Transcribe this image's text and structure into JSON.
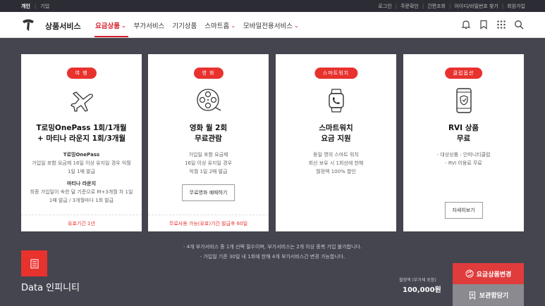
{
  "topbar": {
    "personal": "개인",
    "business": "기업",
    "links": [
      "로그인",
      "주문확인",
      "간편조회",
      "아이디/비밀번호 찾기",
      "회원가입"
    ]
  },
  "header": {
    "brand": "상품서비스",
    "nav": [
      {
        "label": "요금상품",
        "has_chevron": true,
        "active": true
      },
      {
        "label": "부가서비스",
        "has_chevron": false
      },
      {
        "label": "기기상품",
        "has_chevron": false
      },
      {
        "label": "스마트홈",
        "has_chevron": true
      },
      {
        "label": "모바일전용서비스",
        "has_chevron": true
      }
    ],
    "icons": [
      "bell-icon",
      "bookmark-icon",
      "grid-menu-icon",
      "search-icon"
    ]
  },
  "cards": [
    {
      "tag": "여 행",
      "icon": "airplane-icon",
      "title1": "T로밍OnePass 1회/1개월",
      "title2": "+ 마티나 라운지 1회/3개월",
      "desc": [
        {
          "text": "T로밍OnePass",
          "sub": true
        },
        {
          "text": "가입일 포함 요금제 16일 이상 유지일 경우 익월"
        },
        {
          "text": "1일 1매 발급"
        },
        {
          "text": "마티나 라운지",
          "sub": true
        },
        {
          "text": "최종 가입일이 속한 달 기준으로 M+3개월 차 1일"
        },
        {
          "text": "1매 발급 / 3개월마다 1회 발급"
        }
      ],
      "footer": "유효기간 1년"
    },
    {
      "tag": "영 화",
      "icon": "film-reel-icon",
      "title1": "영화 월 2회",
      "title2": "무료관람",
      "desc": [
        {
          "text": "가입일 포함 요금제"
        },
        {
          "text": "16일 이상 유지일 경우"
        },
        {
          "text": "익월 1일 2매 발급"
        }
      ],
      "button": "무료영화 예매하기",
      "footer": "무료사용 가능(유효)기간 발급후 60일"
    },
    {
      "tag": "스마트워치",
      "icon": "smartwatch-icon",
      "title1": "스마트워치",
      "title2": "요금 지원",
      "desc": [
        {
          "text": "동일 명의 스마트 워치"
        },
        {
          "text": "회선 보유 시 1회선에 한해"
        },
        {
          "text": "월정액 100% 할인"
        }
      ]
    },
    {
      "tag": "클럽옵션",
      "icon": "phone-shield-icon",
      "title1": "RVI 상품",
      "title2": "무료",
      "desc": [
        {
          "text": "- 대상상품 : 인피니티클럽"
        },
        {
          "text": "- RVI 이용료 무료"
        }
      ],
      "button": "자세히보기"
    }
  ],
  "notes": [
    "- 4개 부가서비스 중 1개 선택 필수이며, 부가서비스는 2개 이상 중복 가입 불가합니다.",
    "- 가입일 기준 30일 내 1회에 한해 4개 부가서비스간 변경 가능합니다."
  ],
  "plan": {
    "name": "Data 인피니티",
    "price_label": "월정액 (부가세 포함)",
    "price": "100,000원",
    "change_button": "요금상품변경",
    "keep_button": "보관함담기"
  },
  "colors": {
    "accent": "#e8322e",
    "background": "#44454f"
  }
}
